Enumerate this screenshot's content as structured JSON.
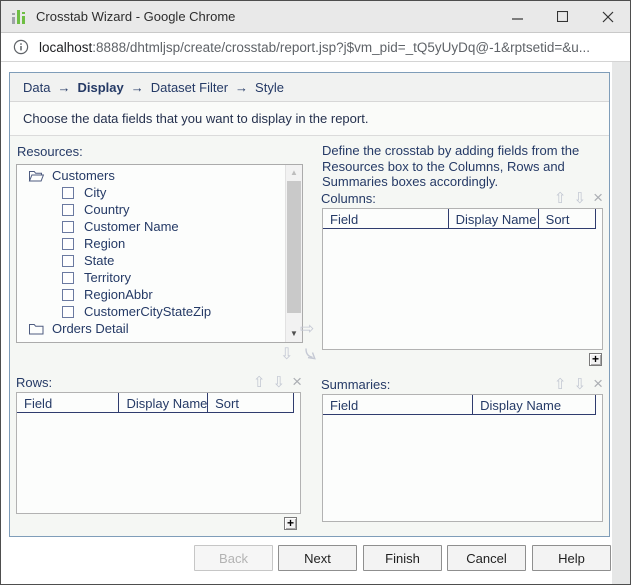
{
  "window": {
    "title": "Crosstab Wizard - Google Chrome"
  },
  "url_bar": {
    "host": "localhost",
    "path": ":8888/dhtmljsp/create/crosstab/report.jsp?j$vm_pid=_tQ5yUyDq@-1&rptsetid=&u..."
  },
  "breadcrumb": {
    "separator": "→",
    "steps": [
      {
        "label": "Data",
        "current": false
      },
      {
        "label": "Display",
        "current": true
      },
      {
        "label": "Dataset Filter",
        "current": false
      },
      {
        "label": "Style",
        "current": false
      }
    ]
  },
  "instruction": "Choose the data fields that you want to display in the report.",
  "resources": {
    "label": "Resources:",
    "tree": [
      {
        "label": "Customers",
        "type": "folder-open",
        "checkbox": false
      },
      {
        "label": "City",
        "type": "field",
        "checkbox": true,
        "checked": false
      },
      {
        "label": "Country",
        "type": "field",
        "checkbox": true,
        "checked": false
      },
      {
        "label": "Customer Name",
        "type": "field",
        "checkbox": true,
        "checked": false
      },
      {
        "label": "Region",
        "type": "field",
        "checkbox": true,
        "checked": false
      },
      {
        "label": "State",
        "type": "field",
        "checkbox": true,
        "checked": false
      },
      {
        "label": "Territory",
        "type": "field",
        "checkbox": true,
        "checked": false
      },
      {
        "label": "RegionAbbr",
        "type": "field",
        "checkbox": true,
        "checked": false
      },
      {
        "label": "CustomerCityStateZip",
        "type": "field",
        "checkbox": true,
        "checked": false
      },
      {
        "label": "Orders Detail",
        "type": "folder-closed",
        "checkbox": false
      }
    ]
  },
  "define_text": "Define the crosstab by adding fields from the Resources box to the Columns, Rows and Summaries boxes accordingly.",
  "columns_panel": {
    "label": "Columns:",
    "headers": [
      "Field",
      "Display Name",
      "Sort"
    ],
    "rows": [],
    "add_button": "+"
  },
  "rows_panel": {
    "label": "Rows:",
    "headers": [
      "Field",
      "Display Name",
      "Sort"
    ],
    "rows": [],
    "add_button": "+"
  },
  "summaries_panel": {
    "label": "Summaries:",
    "headers": [
      "Field",
      "Display Name"
    ],
    "rows": []
  },
  "icons": {
    "up": "⇧",
    "down": "⇩",
    "right": "⇨",
    "remove": "×",
    "scroll_up": "▲",
    "scroll_down": "▼"
  },
  "footer": {
    "buttons": [
      {
        "label": "Back",
        "disabled": true
      },
      {
        "label": "Next",
        "disabled": false
      },
      {
        "label": "Finish",
        "disabled": false
      },
      {
        "label": "Cancel",
        "disabled": false
      },
      {
        "label": "Help",
        "disabled": false
      }
    ]
  },
  "colors": {
    "accent_text": "#253a66",
    "panel_border": "#7f9db9",
    "table_header_line": "#2f3c6e",
    "app_icon_green": "#6fbe44",
    "titlebar_bg": "#e9e9e9"
  }
}
